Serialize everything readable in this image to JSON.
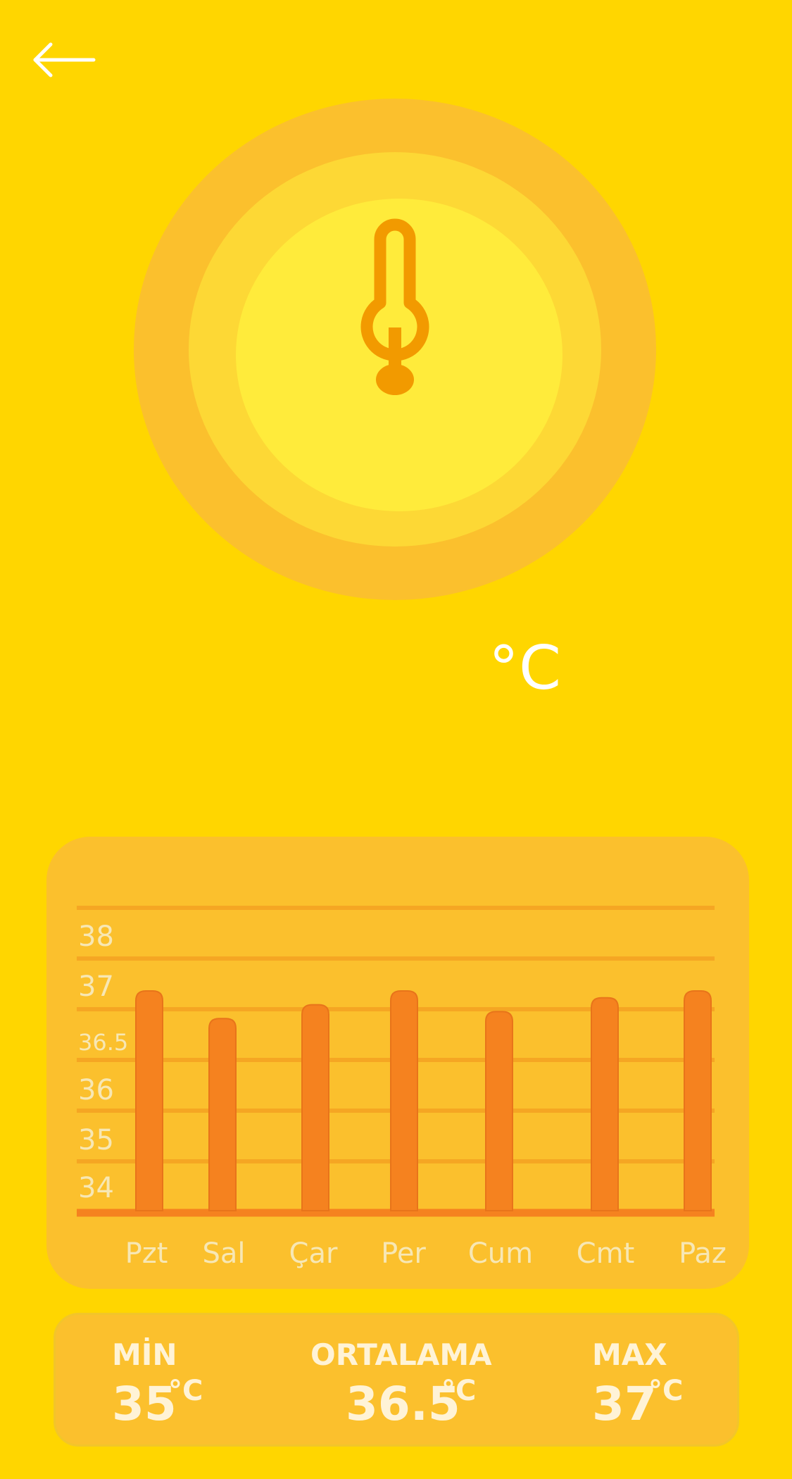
{
  "header": {
    "back_icon": "arrow-left-icon"
  },
  "gauge": {
    "icon": "thermometer-icon",
    "unit": "°C",
    "colors": {
      "outer": "#FBC02D",
      "middle": "#FDD835",
      "inner": "#FFEB3B",
      "icon": "#F29A00"
    }
  },
  "chart_data": {
    "type": "bar",
    "categories": [
      "Pzt",
      "Sal",
      "Çar",
      "Per",
      "Cum",
      "Cmt",
      "Paz"
    ],
    "values": [
      37.0,
      36.6,
      36.8,
      37.0,
      36.7,
      36.9,
      37.0
    ],
    "y_ticks": [
      "38",
      "37",
      "36.5",
      "36",
      "35",
      "34"
    ],
    "grid": true,
    "bar_color": "#F5821F",
    "grid_color": "#F5A623"
  },
  "stats": {
    "min_label": "MİN",
    "min_value": "35",
    "avg_label": "ORTALAMA",
    "avg_value": "36.5",
    "max_label": "MAX",
    "max_value": "37",
    "unit": "°C"
  },
  "colors": {
    "background": "#FFD600",
    "card": "#FBC02D",
    "text_light": "#FFF3D6",
    "label_muted": "#F7E7B4"
  }
}
